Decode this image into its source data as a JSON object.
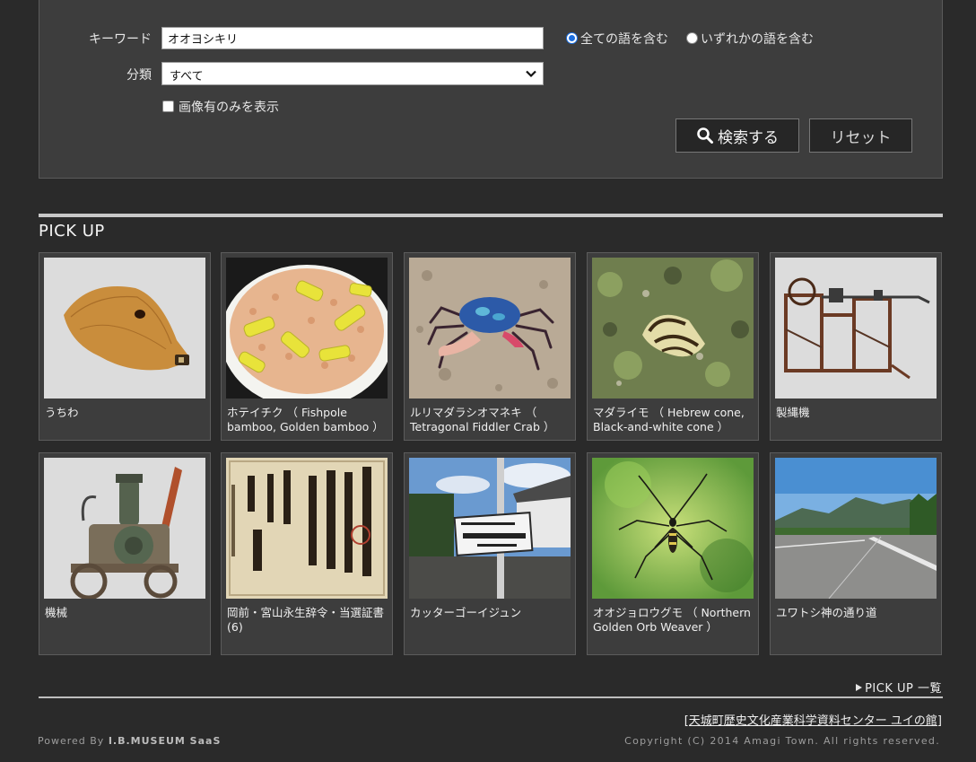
{
  "search": {
    "keyword_label": "キーワード",
    "keyword_value": "オオヨシキリ",
    "match_all_label": "全ての語を含む",
    "match_any_label": "いずれかの語を含む",
    "category_label": "分類",
    "category_value": "すべて",
    "image_only_label": "画像有のみを表示",
    "search_button": "検索する",
    "reset_button": "リセット"
  },
  "pickup": {
    "title": "PICK UP",
    "list_link": "PICK UP 一覧",
    "items": [
      {
        "caption": "うちわ",
        "icon": "fan-image"
      },
      {
        "caption": "ホテイチク （ Fishpole bamboo, Golden bamboo ）",
        "icon": "rice-bowl-image"
      },
      {
        "caption": "ルリマダラシオマネキ （ Tetragonal Fiddler Crab ）",
        "icon": "crab-image"
      },
      {
        "caption": "マダライモ （ Hebrew cone, Black-and-white cone ）",
        "icon": "shell-image"
      },
      {
        "caption": "製縄機",
        "icon": "rope-machine-image"
      },
      {
        "caption": "機械",
        "icon": "engine-machine-image"
      },
      {
        "caption": "岡前・宮山永生辞令・当選証書(6)",
        "icon": "document-image"
      },
      {
        "caption": "カッターゴーイジュン",
        "icon": "signboard-image"
      },
      {
        "caption": "オオジョロウグモ （ Northern Golden Orb Weaver ）",
        "icon": "spider-image"
      },
      {
        "caption": "ユワトシ神の通り道",
        "icon": "road-image"
      }
    ]
  },
  "footer": {
    "center_link": "[天城町歴史文化産業科学資料センター ユイの館]",
    "powered_prefix": "Powered By",
    "powered_brand": "I.B.MUSEUM SaaS",
    "copyright": "Copyright (C) 2014 Amagi Town. All rights reserved."
  },
  "colors": {
    "background": "#2a2a2a",
    "panel": "#3d3d3d",
    "radio_selected": "#1c6fe0"
  }
}
